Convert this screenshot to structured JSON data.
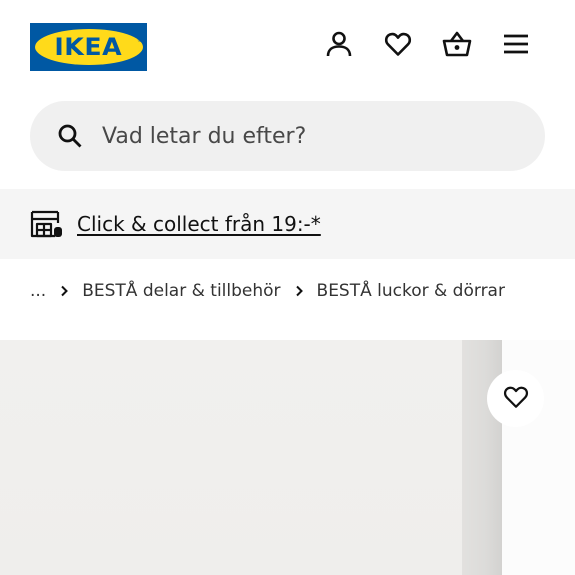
{
  "header": {
    "logo_text": "IKEA",
    "logo_registered": "®",
    "icons": [
      "account-icon",
      "wishlist-heart-icon",
      "shopping-bag-icon",
      "hamburger-menu-icon"
    ]
  },
  "search": {
    "placeholder": "Vad letar du efter?"
  },
  "banner": {
    "link_text": "Click & collect från 19:-*"
  },
  "breadcrumb": {
    "ellipsis": "...",
    "items": [
      "BESTÅ delar & tillbehör",
      "BESTÅ luckor & dörrar"
    ]
  },
  "colors": {
    "brand_blue": "#0058a3",
    "brand_yellow": "#ffda1a",
    "search_bg": "#f0f0f0",
    "banner_bg": "#f5f5f5"
  }
}
